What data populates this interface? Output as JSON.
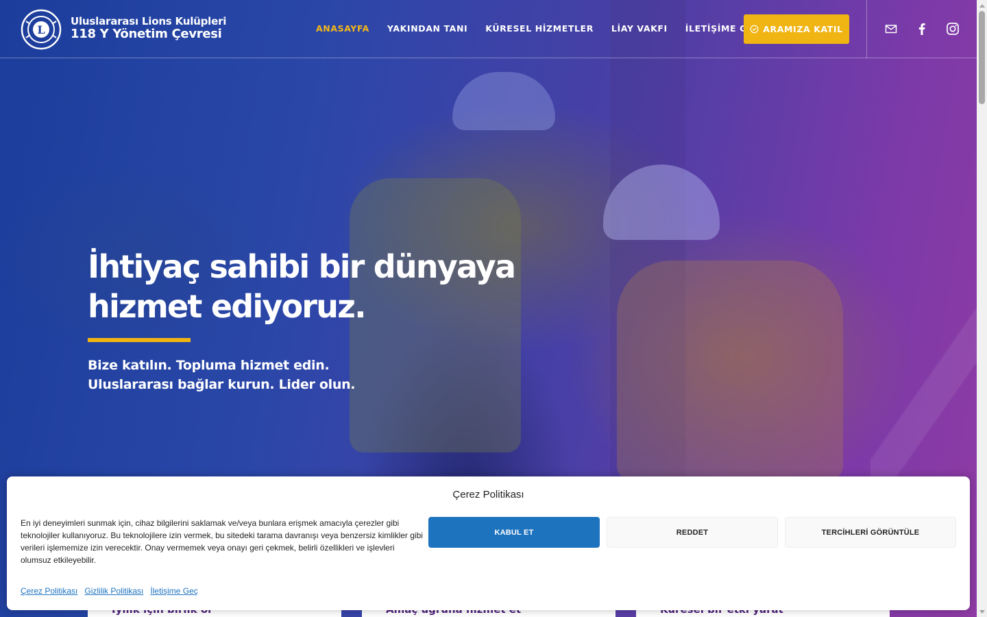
{
  "brand": {
    "line1": "Uluslararası Lions Kulüpleri",
    "line2": "118 Y Yönetim Çevresi",
    "logo_icon": "lions-international-logo"
  },
  "nav": {
    "items": [
      {
        "label": "ANASAYFA",
        "active": true
      },
      {
        "label": "YAKINDAN TANI",
        "active": false
      },
      {
        "label": "KÜRESEL HİZMETLER",
        "active": false
      },
      {
        "label": "LİAY VAKFI",
        "active": false
      },
      {
        "label": "İLETİŞİME GEÇ",
        "active": false
      }
    ],
    "cta_label": "ARAMIZA KATIL",
    "cta_icon": "check-circle-icon",
    "social_icons": [
      "mail-icon",
      "facebook-icon",
      "instagram-icon"
    ]
  },
  "hero": {
    "title_line1": "İhtiyaç sahibi bir dünyaya",
    "title_line2": "hizmet ediyoruz.",
    "sub_line1": "Bize katılın. Topluma hizmet edin.",
    "sub_line2": "Uluslararası bağlar kurun. Lider olun."
  },
  "cards": [
    {
      "title": "Iyilik için birlik ol"
    },
    {
      "title": "Amaç uğruna hizmet et"
    },
    {
      "title": "Küresel bir etki yarat"
    }
  ],
  "cookie": {
    "title": "Çerez Politikası",
    "text": "En iyi deneyimleri sunmak için, cihaz bilgilerini saklamak ve/veya bunlara erişmek amacıyla çerezler gibi teknolojiler kullanıyoruz. Bu teknolojilere izin vermek, bu sitedeki tarama davranışı veya benzersiz kimlikler gibi verileri işlememize izin verecektir. Onay vermemek veya onayı geri çekmek, belirli özellikleri ve işlevleri olumsuz etkileyebilir.",
    "accept_label": "KABUL ET",
    "deny_label": "REDDET",
    "prefs_label": "TERCİHLERİ GÖRÜNTÜLE",
    "links": [
      "Çerez Politikası",
      "Gizlilik Politikası",
      "İletişime Geç"
    ]
  },
  "colors": {
    "accent_yellow": "#f0b413",
    "accept_blue": "#1e73be",
    "card_title_purple": "#4b1d7a"
  }
}
